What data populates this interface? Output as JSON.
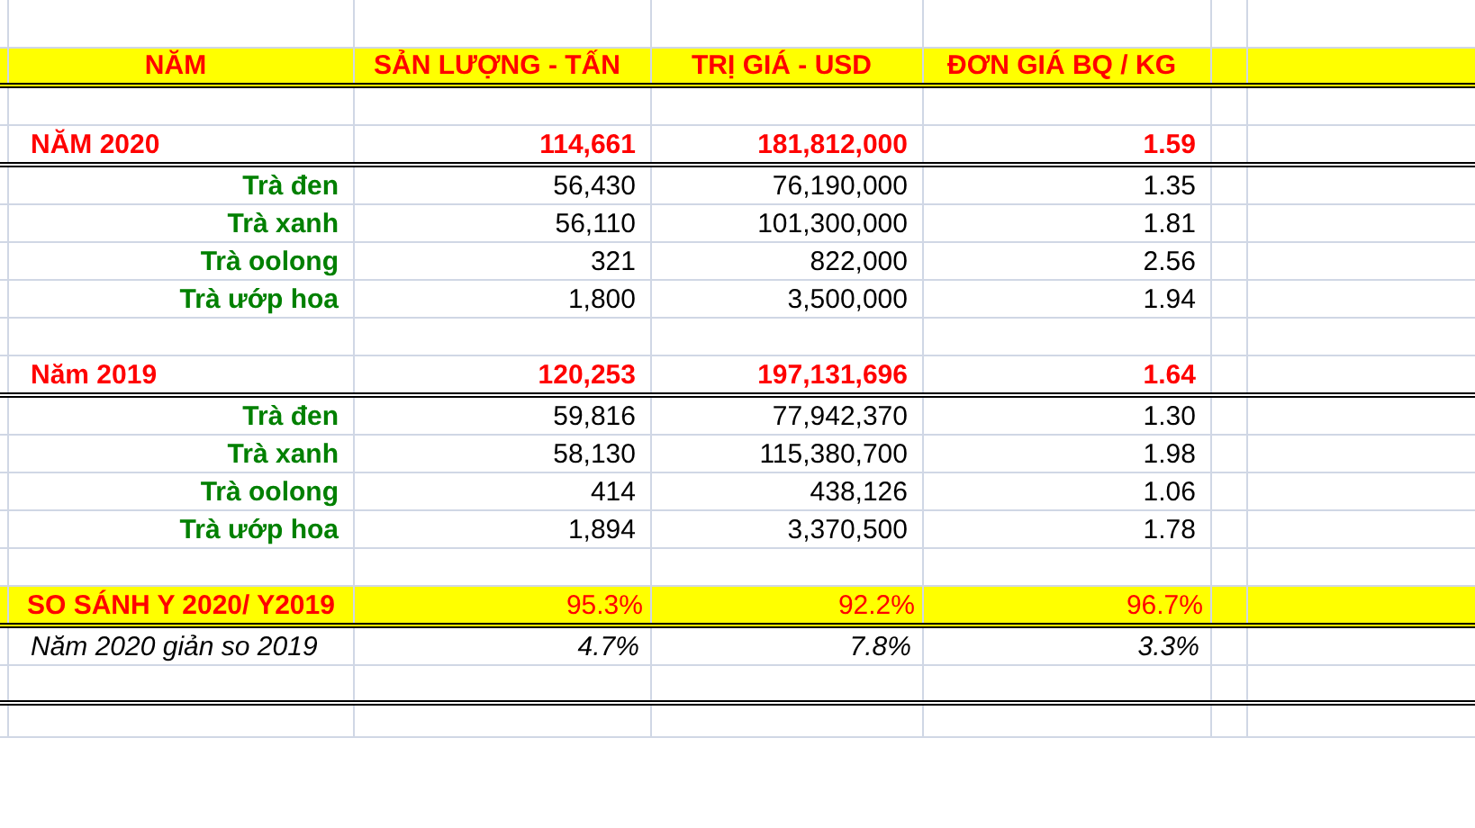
{
  "columns": [
    "NĂM",
    "SẢN LƯỢNG - TẤN",
    "TRỊ GIÁ - USD",
    "ĐƠN GIÁ BQ / KG"
  ],
  "rows": [
    {
      "kind": "blank"
    },
    {
      "kind": "year",
      "cells": [
        "NĂM 2020",
        "114,661",
        "181,812,000",
        "1.59"
      ]
    },
    {
      "kind": "item",
      "cells": [
        "Trà đen",
        "56,430",
        "76,190,000",
        "1.35"
      ]
    },
    {
      "kind": "item",
      "cells": [
        "Trà xanh",
        "56,110",
        "101,300,000",
        "1.81"
      ]
    },
    {
      "kind": "item",
      "cells": [
        "Trà oolong",
        "321",
        "822,000",
        "2.56"
      ]
    },
    {
      "kind": "item",
      "cells": [
        "Trà ướp hoa",
        "1,800",
        "3,500,000",
        "1.94"
      ]
    },
    {
      "kind": "blank"
    },
    {
      "kind": "year",
      "cells": [
        "Năm 2019",
        "120,253",
        "197,131,696",
        "1.64"
      ]
    },
    {
      "kind": "item",
      "cells": [
        "Trà đen",
        "59,816",
        "77,942,370",
        "1.30"
      ]
    },
    {
      "kind": "item",
      "cells": [
        "Trà xanh",
        "58,130",
        "115,380,700",
        "1.98"
      ]
    },
    {
      "kind": "item",
      "cells": [
        "Trà oolong",
        "414",
        "438,126",
        "1.06"
      ]
    },
    {
      "kind": "item",
      "cells": [
        "Trà ướp hoa",
        "1,894",
        "3,370,500",
        "1.78"
      ]
    },
    {
      "kind": "blank"
    },
    {
      "kind": "compare",
      "cells": [
        "SO SÁNH Y 2020/ Y2019",
        "95.3%",
        "92.2%",
        "96.7%"
      ]
    },
    {
      "kind": "note",
      "cells": [
        "Năm 2020 giản so 2019",
        "4.7%",
        "7.8%",
        "3.3%"
      ]
    },
    {
      "kind": "end"
    }
  ]
}
